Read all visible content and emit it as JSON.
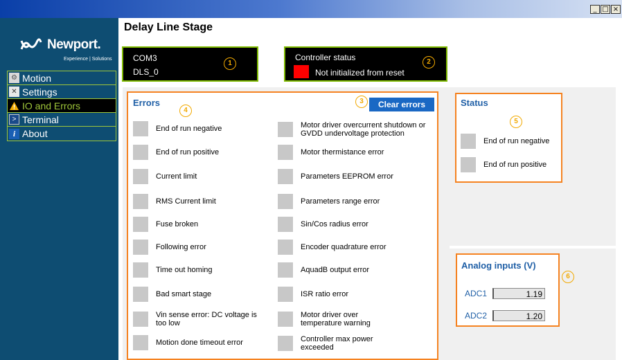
{
  "window": {
    "min_label": "_",
    "max_label": "□",
    "close_label": "×"
  },
  "logo": {
    "brand": "Newport.",
    "tagline": "Experience | Solutions"
  },
  "nav": [
    {
      "label": "Motion",
      "icon": "gear-icon",
      "active": false
    },
    {
      "label": "Settings",
      "icon": "wrench-icon",
      "active": false
    },
    {
      "label": "IO and Errors",
      "icon": "warning-icon",
      "active": true
    },
    {
      "label": "Terminal",
      "icon": "terminal-icon",
      "active": false
    },
    {
      "label": "About",
      "icon": "info-icon",
      "active": false
    }
  ],
  "page": {
    "title": "Delay Line Stage"
  },
  "connection": {
    "port": "COM3",
    "device": "DLS_0",
    "marker": "1"
  },
  "controller_status": {
    "title": "Controller status",
    "state": "Not initialized from reset",
    "color": "#ff0000",
    "marker": "2"
  },
  "errors": {
    "title": "Errors",
    "marker": "4",
    "clear_marker": "3",
    "clear_label": "Clear errors",
    "left": [
      "End of run negative",
      "End of run positive",
      "Current limit",
      "RMS Current limit",
      "Fuse broken",
      "Following error",
      "Time out homing",
      "Bad smart stage",
      "Vin sense error: DC voltage is too low",
      "Motion done timeout error"
    ],
    "right": [
      "Motor driver overcurrent shutdown or GVDD undervoltage protection",
      "Motor thermistance error",
      "Parameters EEPROM error",
      "Parameters range error",
      "Sin/Cos radius error",
      "Encoder quadrature error",
      "AquadB output error",
      "ISR ratio error",
      "Motor driver over temperature warning",
      "Controller max power exceeded"
    ]
  },
  "status": {
    "title": "Status",
    "marker": "5",
    "items": [
      "End of run negative",
      "End of run positive"
    ]
  },
  "analog": {
    "title": "Analog inputs (V)",
    "marker": "6",
    "inputs": [
      {
        "label": "ADC1",
        "value": "1.19"
      },
      {
        "label": "ADC2",
        "value": "1.20"
      }
    ]
  },
  "colors": {
    "accent_green": "#7fba00",
    "accent_orange": "#f58220",
    "sidebar": "#0e4d72",
    "button_blue": "#1a68c4",
    "indicator_off": "#c8c8c8"
  }
}
